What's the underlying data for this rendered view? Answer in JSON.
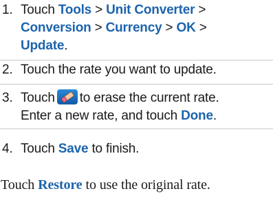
{
  "steps": [
    {
      "number": "1.",
      "pre": "Touch",
      "tools": "Tools",
      "sep1": ">",
      "unit_converter": "Unit Converter",
      "sep2": ">",
      "conversion": "Conversion",
      "sep3": ">",
      "currency": "Currency",
      "sep4": ">",
      "ok": "OK",
      "sep5": ">",
      "update": "Update",
      "end": "."
    },
    {
      "number": "2.",
      "text": "Touch the rate you want to update."
    },
    {
      "number": "3.",
      "pre": "Touch",
      "icon": "eraser-icon",
      "mid": "to erase the current rate.",
      "line2": "Enter a new rate, and touch",
      "done": "Done",
      "end": "."
    },
    {
      "number": "4.",
      "pre": "Touch",
      "save": "Save",
      "post": "to finish."
    }
  ],
  "footer": {
    "pre": "Touch",
    "restore": "Restore",
    "post": "to use the original rate."
  },
  "colors": {
    "keyword": "#1d64ad",
    "text": "#1a1a1a",
    "divider": "#c8c8c8"
  }
}
